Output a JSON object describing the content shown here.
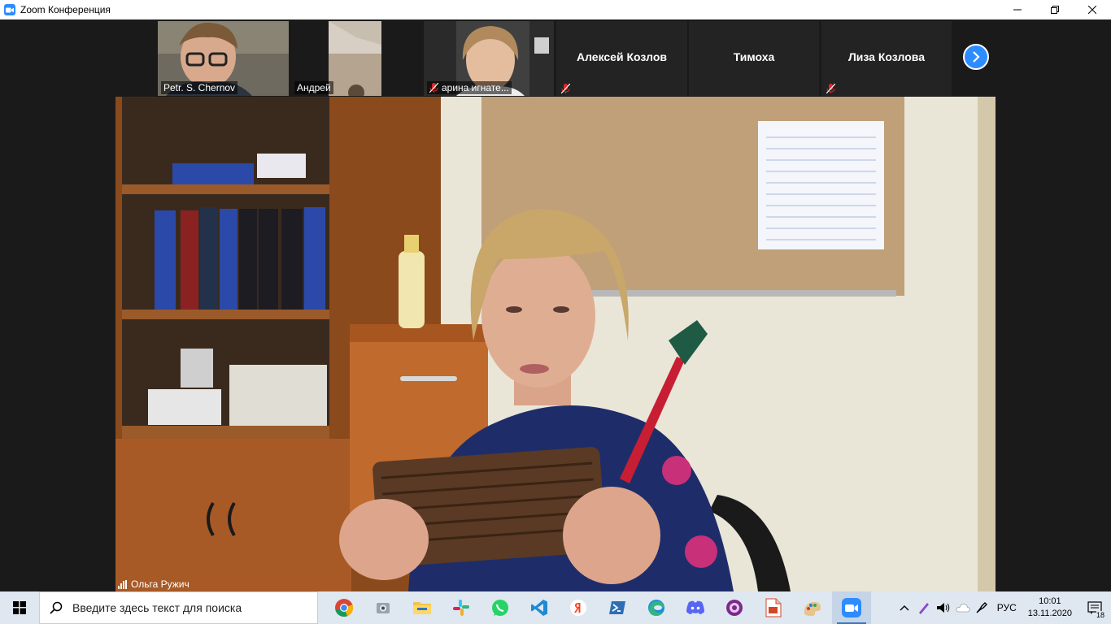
{
  "window": {
    "title": "Zoom Конференция",
    "controls": {
      "minimize": "—",
      "restore": "❐",
      "close": "✕"
    }
  },
  "participants": [
    {
      "name": "Petr. S. Chernov",
      "muted": false,
      "video": true
    },
    {
      "name": "Андрей",
      "muted": false,
      "video": true
    },
    {
      "name": "арина игнате...",
      "muted": true,
      "video": true
    },
    {
      "name": "Алексей Козлов",
      "muted": true,
      "video": false
    },
    {
      "name": "Тимоха",
      "muted": false,
      "video": false
    },
    {
      "name": "Лиза Козлова",
      "muted": true,
      "video": false
    }
  ],
  "active_speaker": {
    "name": "Ольга Ружич"
  },
  "taskbar": {
    "search_placeholder": "Введите здесь текст для поиска",
    "apps": [
      "chrome-icon",
      "snipping-icon",
      "file-explorer-icon",
      "slack-icon",
      "whatsapp-icon",
      "vscode-icon",
      "yandex-icon",
      "powershell-icon",
      "edge-icon",
      "discord-icon",
      "app-purple-icon",
      "document-icon",
      "paint-icon",
      "zoom-icon"
    ],
    "active_app": "zoom-icon",
    "language": "РУС",
    "time": "10:01",
    "date": "13.11.2020",
    "notifications": "18"
  },
  "colors": {
    "zoom_blue": "#2d8cff",
    "mic_muted": "#e02828",
    "taskbar": "#dfe7f1"
  }
}
